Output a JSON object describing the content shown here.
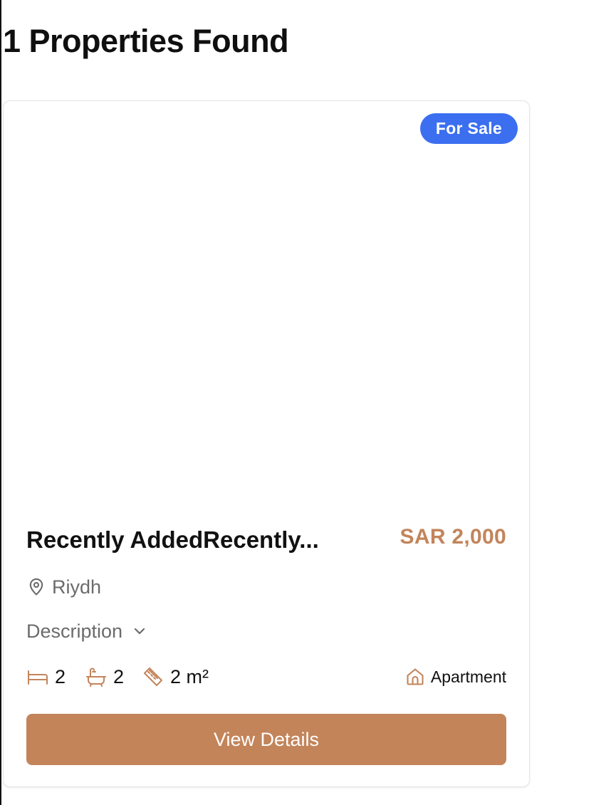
{
  "results": {
    "title": "1 Properties Found"
  },
  "listing": {
    "badge": "For Sale",
    "title": "Recently AddedRecently...",
    "price": "SAR 2,000",
    "location": "Riydh",
    "description_label": "Description",
    "bedrooms": "2",
    "bathrooms": "2",
    "area": "2 m²",
    "property_type": "Apartment",
    "view_button": "View Details"
  },
  "icons": {
    "location": "map-pin-icon",
    "description_toggle": "chevron-down-icon",
    "bedrooms": "bed-icon",
    "bathrooms": "bathtub-icon",
    "area": "ruler-icon",
    "property_type": "house-icon"
  },
  "colors": {
    "accent": "#c3845a",
    "badge": "#3b6ff0",
    "muted_text": "#6b6b6b"
  }
}
